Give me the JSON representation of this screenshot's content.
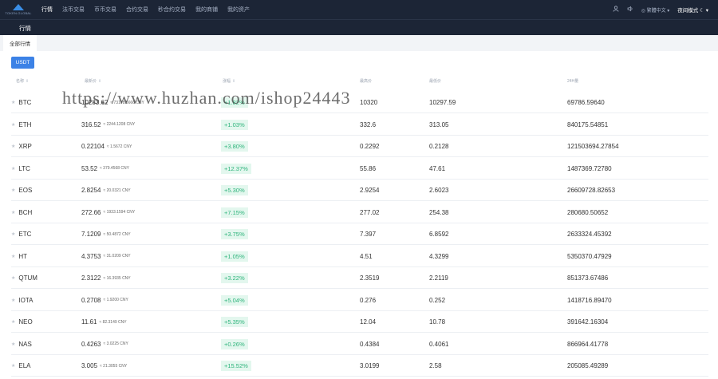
{
  "brand": {
    "logo_text": "TOKEN.GLOBAL"
  },
  "nav": {
    "items": [
      "行情",
      "法币交易",
      "币币交易",
      "合约交易",
      "秒合约交易",
      "我的商铺",
      "我的资产"
    ],
    "active_index": 0
  },
  "topright": {
    "language": "繁體中文",
    "night_mode": "夜间模式"
  },
  "subbar": {
    "title": "行情"
  },
  "tabs": {
    "all": "全部行情"
  },
  "quote_button": "USDT",
  "columns": [
    "名称",
    "最新价",
    "涨幅",
    "最高价",
    "最低价",
    "24H量"
  ],
  "rows": [
    {
      "name": "BTC",
      "price": "10283.62",
      "cny": "≈ 73178.5666 CNY",
      "change": "+1.82%",
      "high": "10320",
      "low": "10297.59",
      "volume": "69786.59640"
    },
    {
      "name": "ETH",
      "price": "316.52",
      "cny": "≈ 2244.1208 CNY",
      "change": "+1.03%",
      "high": "332.6",
      "low": "313.05",
      "volume": "840175.54851"
    },
    {
      "name": "XRP",
      "price": "0.22104",
      "cny": "≈ 1.5672 CNY",
      "change": "+3.80%",
      "high": "0.2292",
      "low": "0.2128",
      "volume": "121503694.27854"
    },
    {
      "name": "LTC",
      "price": "53.52",
      "cny": "≈ 379.4568 CNY",
      "change": "+12.37%",
      "high": "55.86",
      "low": "47.61",
      "volume": "1487369.72780"
    },
    {
      "name": "EOS",
      "price": "2.8254",
      "cny": "≈ 20.0321 CNY",
      "change": "+5.30%",
      "high": "2.9254",
      "low": "2.6023",
      "volume": "26609728.82653"
    },
    {
      "name": "BCH",
      "price": "272.66",
      "cny": "≈ 1933.1594 CNY",
      "change": "+7.15%",
      "high": "277.02",
      "low": "254.38",
      "volume": "280680.50652"
    },
    {
      "name": "ETC",
      "price": "7.1209",
      "cny": "≈ 50.4872 CNY",
      "change": "+3.75%",
      "high": "7.397",
      "low": "6.8592",
      "volume": "2633324.45392"
    },
    {
      "name": "HT",
      "price": "4.3753",
      "cny": "≈ 31.0209 CNY",
      "change": "+1.05%",
      "high": "4.51",
      "low": "4.3299",
      "volume": "5350370.47929"
    },
    {
      "name": "QTUM",
      "price": "2.3122",
      "cny": "≈ 16.3935 CNY",
      "change": "+3.22%",
      "high": "2.3519",
      "low": "2.2119",
      "volume": "851373.67486"
    },
    {
      "name": "IOTA",
      "price": "0.2708",
      "cny": "≈ 1.9200 CNY",
      "change": "+5.04%",
      "high": "0.276",
      "low": "0.252",
      "volume": "1418716.89470"
    },
    {
      "name": "NEO",
      "price": "11.61",
      "cny": "≈ 82.3149 CNY",
      "change": "+5.35%",
      "high": "12.04",
      "low": "10.78",
      "volume": "391642.16304"
    },
    {
      "name": "NAS",
      "price": "0.4263",
      "cny": "≈ 3.0225 CNY",
      "change": "+0.26%",
      "high": "0.4384",
      "low": "0.4061",
      "volume": "866964.41778"
    },
    {
      "name": "ELA",
      "price": "3.005",
      "cny": "≈ 21.3055 CNY",
      "change": "+15.52%",
      "high": "3.0199",
      "low": "2.58",
      "volume": "205085.49289"
    }
  ],
  "watermark": "https://www.huzhan.com/ishop24443",
  "colors": {
    "topbar": "#1c2536",
    "accent": "#3c82e6",
    "up": "#2fb47c",
    "up_bg": "#e3f7ee"
  }
}
